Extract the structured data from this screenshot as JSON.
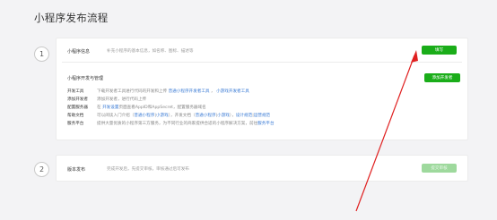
{
  "page_title": "小程序发布流程",
  "steps": [
    {
      "number": "1",
      "name": "小程序信息",
      "desc": "补充小程序的基本信息，如名称、图标、描述等",
      "button": "填写",
      "dev_section": {
        "title": "小程序开发与管理",
        "button": "添加开发者",
        "rows": [
          {
            "key": "开发工具",
            "text": "下载开发者工具进行代码的开发和上传",
            "links": [
              "普通小程序开发者工具",
              "小游戏开发者工具"
            ]
          },
          {
            "key": "添加开发者",
            "text": "添加开发者，进行代码上传",
            "links": []
          },
          {
            "key": "配置服务器",
            "text_before": "在",
            "link_mid": "开发设置",
            "text": "页面查看AppID和AppSecret，配置服务器域名",
            "links": []
          },
          {
            "key": "帮助文档",
            "text": "可以阅读入门介绍（",
            "links": [
              "普通小程序",
              "小游戏",
              "普通小程序",
              "小游戏",
              "设计规范",
              "运营规范"
            ],
            "middle": "），开发文档（"
          },
          {
            "key": "服务平台",
            "text": "提供大量优质的小程序第三方服务，为不同行业的商家提供合适的小程序解决方案，前往",
            "links": [
              "服务平台"
            ]
          }
        ]
      }
    },
    {
      "number": "2",
      "name": "版本发布",
      "desc": "完成开发后，先提交审核，审核通过后可发布",
      "button": "提交审核"
    }
  ],
  "colors": {
    "accent": "#1aad19",
    "link": "#3a7bd5",
    "arrow": "#e02020"
  }
}
